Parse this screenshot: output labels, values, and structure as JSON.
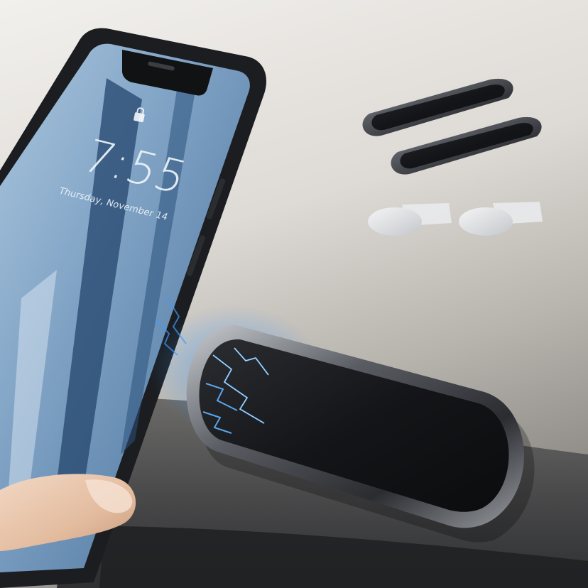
{
  "phone": {
    "lock_time": "7:55",
    "lock_date": "Thursday, November 14"
  },
  "colors": {
    "background_top": "#efedea",
    "background_mid": "#cbc7c1",
    "dashboard_dark": "#3c3d3f",
    "phone_frame": "#1a1c1f",
    "screen_blue": "#6f93b6",
    "mount_plate": "#121316",
    "mount_rim": "#8d9096",
    "lightning": "#4da6ff",
    "skin": "#e6c2a6",
    "sticker": "#d8dadd"
  },
  "icons": {
    "large_mount": "magnetic-mount-icon",
    "small_mounts": "magnetic-strip-icon",
    "stickers": "metal-disc-icon",
    "lock": "lock-icon",
    "energy": "lightning-icon"
  }
}
